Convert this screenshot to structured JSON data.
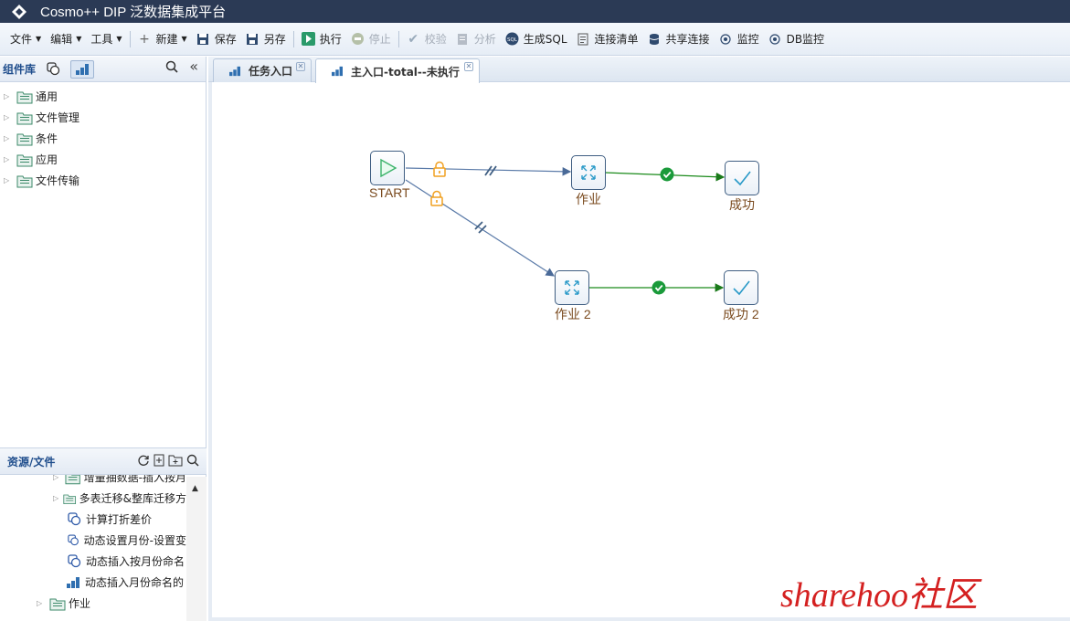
{
  "app": {
    "title": "Cosmo++ DIP 泛数据集成平台"
  },
  "toolbar": {
    "file": "文件",
    "edit": "编辑",
    "tools": "工具",
    "new": "新建",
    "save": "保存",
    "save_as": "另存",
    "execute": "执行",
    "stop": "停止",
    "validate": "校验",
    "analyze": "分析",
    "gen_sql": "生成SQL",
    "conn_list": "连接清单",
    "shared_conn": "共享连接",
    "monitor": "监控",
    "db_monitor": "DB监控"
  },
  "component_panel": {
    "title": "组件库",
    "items": [
      "通用",
      "文件管理",
      "条件",
      "应用",
      "文件传输"
    ]
  },
  "resource_panel": {
    "title": "资源/文件",
    "items": [
      {
        "label": "增量抽数据-插入按月",
        "type": "folder",
        "indent": 2
      },
      {
        "label": "多表迁移&整库迁移方",
        "type": "folder",
        "indent": 2
      },
      {
        "label": "计算打折差价",
        "type": "task",
        "indent": 3
      },
      {
        "label": "动态设置月份-设置变",
        "type": "task",
        "indent": 3
      },
      {
        "label": "动态插入按月份命名",
        "type": "task",
        "indent": 3
      },
      {
        "label": "动态插入月份命名的",
        "type": "flow",
        "indent": 3
      },
      {
        "label": "作业",
        "type": "folder",
        "indent": 1
      }
    ]
  },
  "tabs": [
    {
      "label": "任务入口",
      "active": false
    },
    {
      "label": "主入口-total--未执行",
      "active": true
    }
  ],
  "flow": {
    "start": "START",
    "job1": "作业",
    "success1": "成功",
    "job2": "作业 2",
    "success2": "成功 2"
  },
  "watermark": "sharehoo社区",
  "colors": {
    "titlebar": "#2b3a55",
    "success_line": "#1a8a1a",
    "normal_line": "#5a7aa8",
    "lock": "#f0a020"
  }
}
